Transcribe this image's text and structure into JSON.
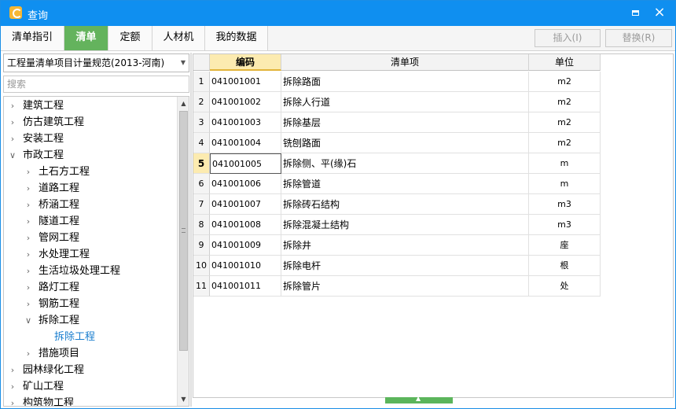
{
  "window": {
    "title": "查询",
    "maximize_label": "",
    "close_glyph": "×"
  },
  "tabs": [
    {
      "label": "清单指引"
    },
    {
      "label": "清单"
    },
    {
      "label": "定额"
    },
    {
      "label": "人材机"
    },
    {
      "label": "我的数据"
    }
  ],
  "toolbar": {
    "insert_label": "插入(I)",
    "replace_label": "替换(R)"
  },
  "left": {
    "spec_selected": "工程量清单项目计量规范(2013-河南)",
    "search_placeholder": "搜索",
    "tree": [
      {
        "label": "建筑工程",
        "level": 0,
        "expanded": false
      },
      {
        "label": "仿古建筑工程",
        "level": 0,
        "expanded": false
      },
      {
        "label": "安装工程",
        "level": 0,
        "expanded": false
      },
      {
        "label": "市政工程",
        "level": 0,
        "expanded": true
      },
      {
        "label": "土石方工程",
        "level": 1,
        "expanded": false
      },
      {
        "label": "道路工程",
        "level": 1,
        "expanded": false
      },
      {
        "label": "桥涵工程",
        "level": 1,
        "expanded": false
      },
      {
        "label": "隧道工程",
        "level": 1,
        "expanded": false
      },
      {
        "label": "管网工程",
        "level": 1,
        "expanded": false
      },
      {
        "label": "水处理工程",
        "level": 1,
        "expanded": false
      },
      {
        "label": "生活垃圾处理工程",
        "level": 1,
        "expanded": false
      },
      {
        "label": "路灯工程",
        "level": 1,
        "expanded": false
      },
      {
        "label": "钢筋工程",
        "level": 1,
        "expanded": false
      },
      {
        "label": "拆除工程",
        "level": 1,
        "expanded": true
      },
      {
        "label": "拆除工程",
        "level": 2,
        "expanded": false
      },
      {
        "label": "措施项目",
        "level": 1,
        "expanded": false
      },
      {
        "label": "园林绿化工程",
        "level": 0,
        "expanded": false
      },
      {
        "label": "矿山工程",
        "level": 0,
        "expanded": false
      },
      {
        "label": "构筑物工程",
        "level": 0,
        "expanded": false
      }
    ]
  },
  "grid": {
    "headers": {
      "code": "编码",
      "name": "清单项",
      "unit": "单位"
    },
    "rows": [
      {
        "num": "1",
        "code": "041001001",
        "name": "拆除路面",
        "unit": "m2"
      },
      {
        "num": "2",
        "code": "041001002",
        "name": "拆除人行道",
        "unit": "m2"
      },
      {
        "num": "3",
        "code": "041001003",
        "name": "拆除基层",
        "unit": "m2"
      },
      {
        "num": "4",
        "code": "041001004",
        "name": "铣刨路面",
        "unit": "m2"
      },
      {
        "num": "5",
        "code": "041001005",
        "name": "拆除侧、平(缘)石",
        "unit": "m"
      },
      {
        "num": "6",
        "code": "041001006",
        "name": "拆除管道",
        "unit": "m"
      },
      {
        "num": "7",
        "code": "041001007",
        "name": "拆除砖石结构",
        "unit": "m3"
      },
      {
        "num": "8",
        "code": "041001008",
        "name": "拆除混凝土结构",
        "unit": "m3"
      },
      {
        "num": "9",
        "code": "041001009",
        "name": "拆除井",
        "unit": "座"
      },
      {
        "num": "10",
        "code": "041001010",
        "name": "拆除电杆",
        "unit": "根"
      },
      {
        "num": "11",
        "code": "041001011",
        "name": "拆除管片",
        "unit": "处"
      }
    ]
  }
}
